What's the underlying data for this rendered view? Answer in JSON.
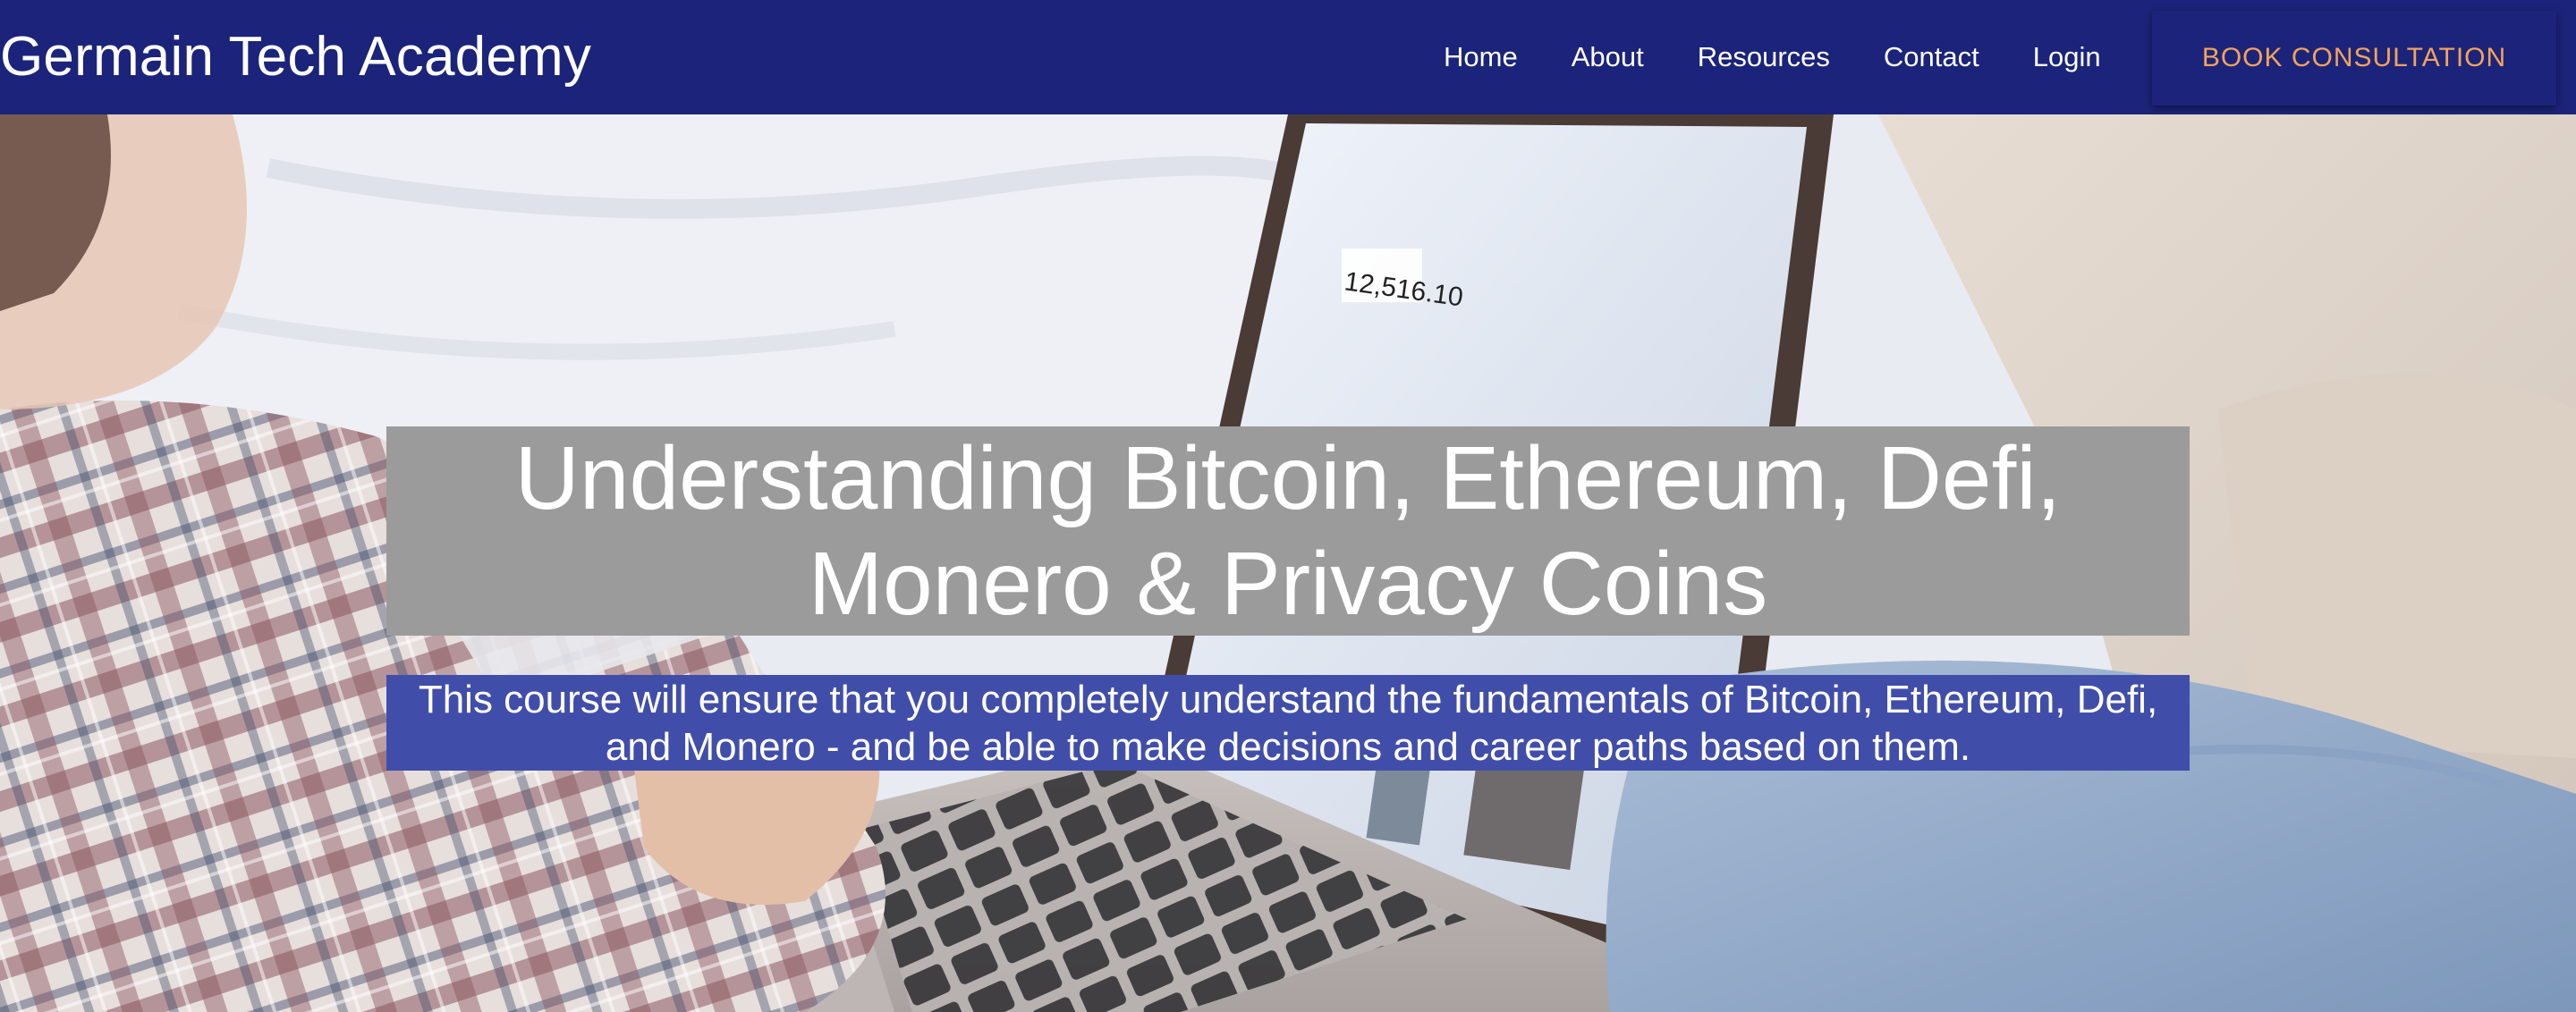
{
  "site": {
    "brand": "Germain Tech Academy"
  },
  "nav": {
    "links": [
      {
        "label": "Home"
      },
      {
        "label": "About"
      },
      {
        "label": "Resources"
      },
      {
        "label": "Contact"
      },
      {
        "label": "Login"
      }
    ],
    "cta_label": "BOOK CONSULTATION"
  },
  "hero": {
    "headline": "Understanding Bitcoin, Ethereum, Defi, Monero & Privacy Coins",
    "subtitle": "This course will ensure that you completely understand the fundamentals of Bitcoin, Ethereum, Defi, and Monero - and be able to make decisions and career paths based on them.",
    "screen_price": "12,516.10"
  },
  "colors": {
    "navbar_bg": "#1b247a",
    "cta_text": "#f3a35a",
    "headline_bg": "#9b9b9b",
    "subtitle_bg": "#414ea9"
  }
}
